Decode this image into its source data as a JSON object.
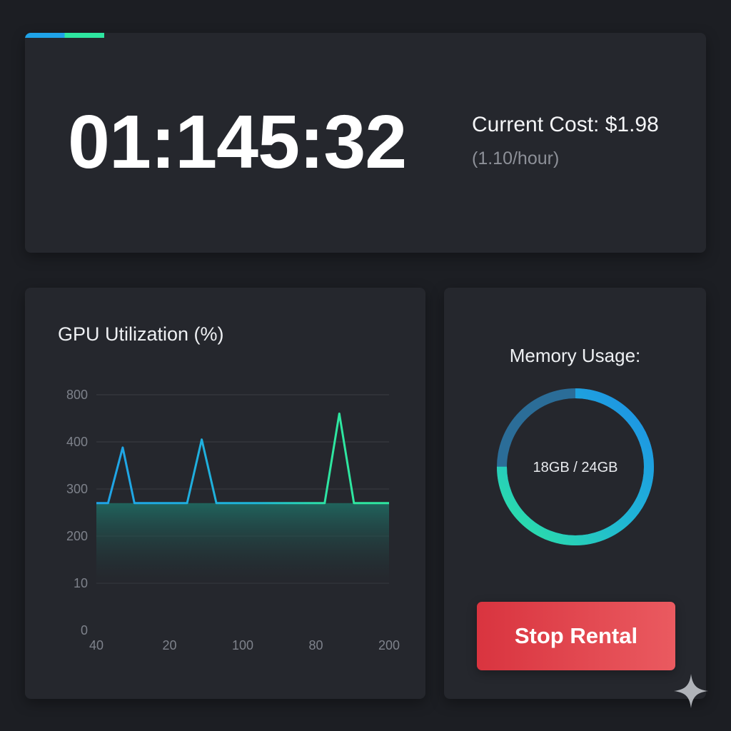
{
  "timer": {
    "elapsed": "01:145:32",
    "progress_fraction": 0.116
  },
  "cost": {
    "current": "Current Cost: $1.98",
    "rate": "(1.10/hour)"
  },
  "gpu": {
    "title": "GPU Utilization (%)"
  },
  "chart_data": {
    "type": "line",
    "title": "GPU Utilization (%)",
    "y_tick_labels": [
      "800",
      "400",
      "300",
      "200",
      "10",
      "0"
    ],
    "x_tick_labels": [
      "40",
      "20",
      "100",
      "80",
      "200"
    ],
    "x_domain": [
      0,
      100
    ],
    "y_domain": [
      0,
      6
    ],
    "series": [
      {
        "points": [
          [
            0,
            2.7
          ],
          [
            4,
            2.7
          ],
          [
            9,
            3.88
          ],
          [
            13,
            2.7
          ],
          [
            31,
            2.7
          ],
          [
            36,
            4.05
          ],
          [
            41,
            2.7
          ],
          [
            78,
            2.7
          ],
          [
            83,
            4.6
          ],
          [
            88,
            2.7
          ],
          [
            100,
            2.7
          ]
        ]
      }
    ],
    "fill_level": 2.7,
    "grid": true
  },
  "memory": {
    "title": "Memory Usage:",
    "label": "18GB / 24GB",
    "used_fraction": 0.75
  },
  "actions": {
    "stop_label": "Stop Rental"
  },
  "colors": {
    "accent_blue": "#1fa3e8",
    "accent_green": "#2ee6a0",
    "danger": "#e2444c",
    "card": "#25272d",
    "background": "#1c1e23"
  },
  "icons": {
    "corner": "sparkle-icon"
  }
}
